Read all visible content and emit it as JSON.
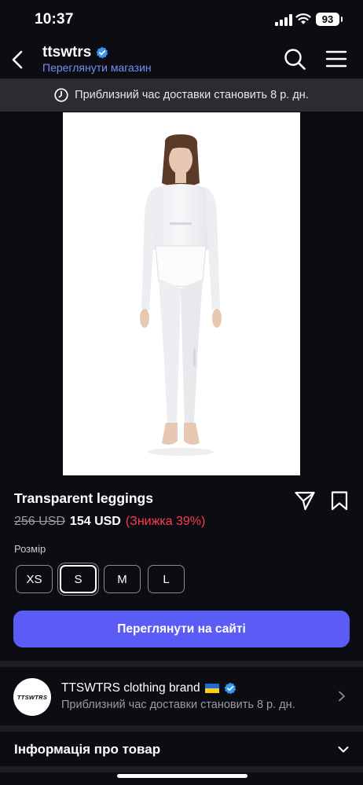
{
  "status_bar": {
    "time": "10:37",
    "battery": "93"
  },
  "nav": {
    "shop_name": "ttswtrs",
    "shop_link": "Переглянути магазин",
    "back_icon": "chevron-left-icon",
    "search_icon": "search-icon",
    "menu_icon": "hamburger-menu-icon"
  },
  "delivery_notice": {
    "text": "Приблизний час доставки становить 8 р. дн.",
    "icon": "clock-icon"
  },
  "product": {
    "title": "Transparent leggings",
    "price_old": "256 USD",
    "price_new": "154 USD",
    "discount": "(Знижка 39%)",
    "image": "model-in-white-sheer-leggings-and-top"
  },
  "sizes": {
    "label": "Розмір",
    "options": [
      "XS",
      "S",
      "M",
      "L"
    ],
    "selected": "S"
  },
  "cta": {
    "label": "Переглянути на сайті"
  },
  "brand": {
    "logo_text": "TTSWTRS",
    "name": "TTSWTRS clothing brand",
    "flag": "ukraine-flag-icon",
    "subtitle": "Приблизний час доставки становить 8 р. дн."
  },
  "info": {
    "title": "Інформація про товар"
  },
  "colors": {
    "accent": "#5b5cf6",
    "link": "#7c8cf8",
    "discount": "#ff3b4f",
    "verified": "#3897f0",
    "background": "#0c0d12"
  }
}
